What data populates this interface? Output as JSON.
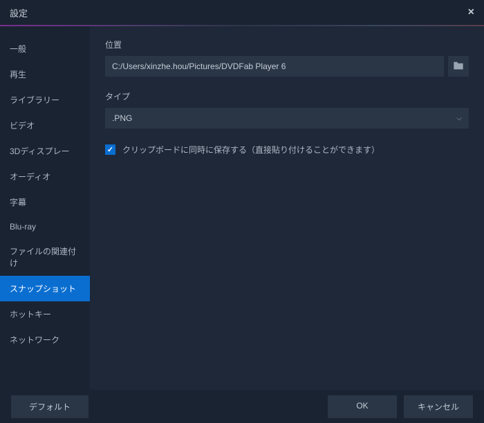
{
  "title": "設定",
  "sidebar": {
    "items": [
      {
        "label": "一般"
      },
      {
        "label": "再生"
      },
      {
        "label": "ライブラリー"
      },
      {
        "label": "ビデオ"
      },
      {
        "label": "3Dディスプレー"
      },
      {
        "label": "オーディオ"
      },
      {
        "label": "字幕"
      },
      {
        "label": "Blu-ray"
      },
      {
        "label": "ファイルの関連付け"
      },
      {
        "label": "スナップショット"
      },
      {
        "label": "ホットキー"
      },
      {
        "label": "ネットワーク"
      }
    ],
    "selected_index": 9
  },
  "content": {
    "location_label": "位置",
    "location_value": "C:/Users/xinzhe.hou/Pictures/DVDFab Player 6",
    "type_label": "タイプ",
    "type_value": ".PNG",
    "clipboard_checked": true,
    "clipboard_label": "クリップボードに同時に保存する（直接貼り付けることができます）"
  },
  "footer": {
    "default_label": "デフォルト",
    "ok_label": "OK",
    "cancel_label": "キャンセル"
  }
}
